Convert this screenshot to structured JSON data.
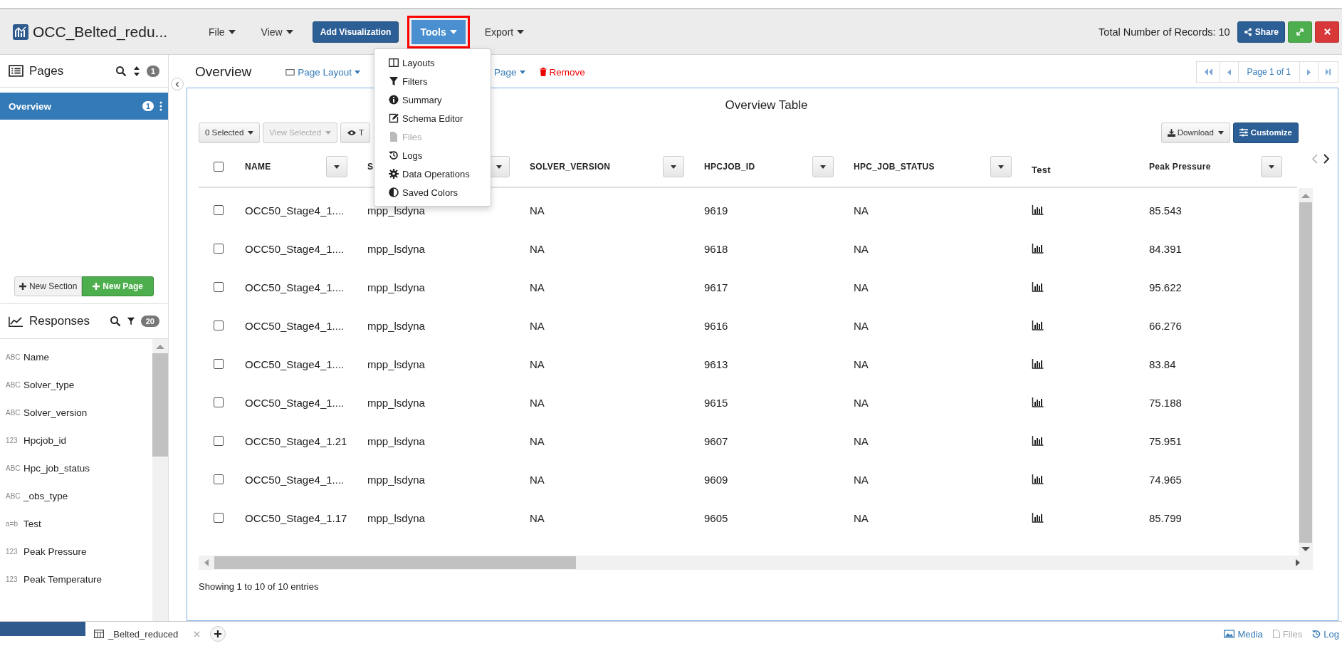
{
  "app": {
    "title": "OCC_Belted_redu...",
    "records": "Total Number of Records: 10",
    "share": "Share",
    "menus": [
      {
        "label": "File",
        "kind": "menu",
        "open": false,
        "highlighted": false
      },
      {
        "label": "View",
        "kind": "menu",
        "open": false,
        "highlighted": false
      },
      {
        "label": "Add Visualization",
        "kind": "button",
        "open": false,
        "highlighted": false
      },
      {
        "label": "Tools",
        "kind": "menu",
        "open": true,
        "highlighted": true
      },
      {
        "label": "Export",
        "kind": "menu",
        "open": false,
        "highlighted": false
      }
    ]
  },
  "tools_menu": {
    "items": [
      {
        "label": "Layouts",
        "kind": "layouts",
        "disabled": false
      },
      {
        "label": "Filters",
        "kind": "filter",
        "disabled": false
      },
      {
        "label": "Summary",
        "kind": "info",
        "disabled": false
      },
      {
        "label": "Schema Editor",
        "kind": "edit",
        "disabled": false
      },
      {
        "label": "Files",
        "kind": "file",
        "disabled": true
      },
      {
        "label": "Logs",
        "kind": "history",
        "disabled": false
      },
      {
        "label": "Data Operations",
        "kind": "gear",
        "disabled": false
      },
      {
        "label": "Saved Colors",
        "kind": "contrast",
        "disabled": false
      }
    ]
  },
  "pages_panel": {
    "title": "Pages",
    "count": "1",
    "new_section": "New Section",
    "new_page": "New Page",
    "pages": [
      {
        "label": "Overview",
        "count": "1",
        "selected": true
      }
    ]
  },
  "responses_panel": {
    "title": "Responses",
    "count": "20",
    "items": [
      {
        "type": "ABC",
        "name": "Name"
      },
      {
        "type": "ABC",
        "name": "Solver_type"
      },
      {
        "type": "ABC",
        "name": "Solver_version"
      },
      {
        "type": "123",
        "name": "Hpcjob_id"
      },
      {
        "type": "ABC",
        "name": "Hpc_job_status"
      },
      {
        "type": "ABC",
        "name": "_obs_type"
      },
      {
        "type": "a=b",
        "name": "Test"
      },
      {
        "type": "123",
        "name": "Peak Pressure"
      },
      {
        "type": "123",
        "name": "Peak Temperature"
      }
    ]
  },
  "page_header": {
    "title": "Overview",
    "pager": "Page 1 of 1",
    "actions": [
      {
        "label": "Page Layout",
        "kind": "layout"
      },
      {
        "label": "Page",
        "kind": "dropdown"
      },
      {
        "label": "Remove",
        "kind": "danger"
      }
    ]
  },
  "table": {
    "title": "Overview Table",
    "select_all_checked": false,
    "download": "Download",
    "customize": "Customize",
    "footer": "Showing 1 to 10 of 10 entries",
    "toolbar": [
      {
        "label": "0 Selected",
        "kind": "dropdown",
        "disabled": false
      },
      {
        "label": "View Selected",
        "kind": "dropdown",
        "disabled": true
      },
      {
        "label": "T",
        "kind": "eye",
        "disabled": false
      }
    ],
    "columns": [
      {
        "label": "NAME",
        "kind": "text",
        "filter": true
      },
      {
        "label": "S",
        "kind": "text",
        "filter": true
      },
      {
        "label": "SOLVER_VERSION",
        "kind": "text",
        "filter": true
      },
      {
        "label": "HPCJOB_ID",
        "kind": "text",
        "filter": true
      },
      {
        "label": "HPC_JOB_STATUS",
        "kind": "text",
        "filter": true
      },
      {
        "label": "Test",
        "kind": "chart",
        "filter": false
      },
      {
        "label": "Peak Pressure",
        "kind": "text",
        "filter": true
      }
    ],
    "rows": [
      {
        "checked": false,
        "cells": [
          "OCC50_Stage4_1....",
          "mpp_lsdyna",
          "NA",
          "9619",
          "NA",
          "85.543"
        ]
      },
      {
        "checked": false,
        "cells": [
          "OCC50_Stage4_1....",
          "mpp_lsdyna",
          "NA",
          "9618",
          "NA",
          "84.391"
        ]
      },
      {
        "checked": false,
        "cells": [
          "OCC50_Stage4_1....",
          "mpp_lsdyna",
          "NA",
          "9617",
          "NA",
          "95.622"
        ]
      },
      {
        "checked": false,
        "cells": [
          "OCC50_Stage4_1....",
          "mpp_lsdyna",
          "NA",
          "9616",
          "NA",
          "66.276"
        ]
      },
      {
        "checked": false,
        "cells": [
          "OCC50_Stage4_1....",
          "mpp_lsdyna",
          "NA",
          "9613",
          "NA",
          "83.84"
        ]
      },
      {
        "checked": false,
        "cells": [
          "OCC50_Stage4_1....",
          "mpp_lsdyna",
          "NA",
          "9615",
          "NA",
          "75.188"
        ]
      },
      {
        "checked": false,
        "cells": [
          "OCC50_Stage4_1.21",
          "mpp_lsdyna",
          "NA",
          "9607",
          "NA",
          "75.951"
        ]
      },
      {
        "checked": false,
        "cells": [
          "OCC50_Stage4_1....",
          "mpp_lsdyna",
          "NA",
          "9609",
          "NA",
          "74.965"
        ]
      },
      {
        "checked": false,
        "cells": [
          "OCC50_Stage4_1.17",
          "mpp_lsdyna",
          "NA",
          "9605",
          "NA",
          "85.799"
        ]
      }
    ]
  },
  "bottom_bar": {
    "tabs": [
      {
        "label": "_Belted_reduced",
        "selected": false
      }
    ],
    "links": [
      {
        "label": "Media",
        "kind": "image",
        "disabled": false
      },
      {
        "label": "Files",
        "kind": "file",
        "disabled": true
      },
      {
        "label": "Log",
        "kind": "history",
        "disabled": false
      }
    ]
  }
}
